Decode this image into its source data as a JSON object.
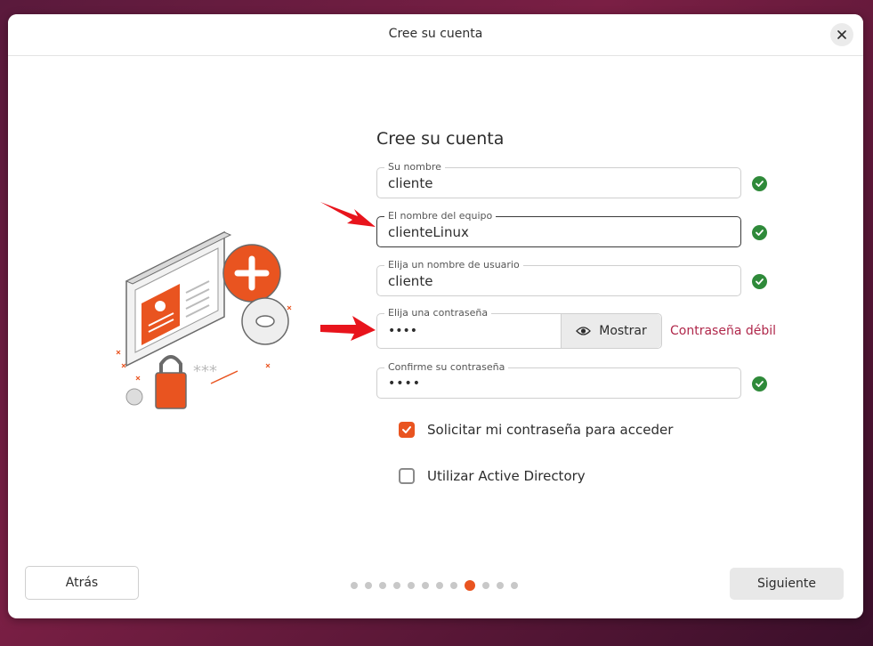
{
  "window": {
    "title": "Cree su cuenta"
  },
  "heading": "Cree su cuenta",
  "fields": {
    "name": {
      "label": "Su nombre",
      "value": "cliente",
      "valid": true
    },
    "computer": {
      "label": "El nombre del equipo",
      "value": "clienteLinux",
      "valid": true
    },
    "username": {
      "label": "Elija un nombre de usuario",
      "value": "cliente",
      "valid": true
    },
    "password": {
      "label": "Elija una contraseña",
      "value": "••••",
      "show_label": "Mostrar",
      "strength": "Contraseña débil"
    },
    "confirm": {
      "label": "Confirme su contraseña",
      "value": "••••",
      "valid": true
    }
  },
  "options": {
    "require_password": {
      "label": "Solicitar mi contraseña para acceder",
      "checked": true
    },
    "active_directory": {
      "label": "Utilizar Active Directory",
      "checked": false
    }
  },
  "buttons": {
    "back": "Atrás",
    "next": "Siguiente"
  },
  "pagination": {
    "total": 12,
    "current": 9
  },
  "colors": {
    "accent": "#e95420",
    "valid": "#2f8a3a",
    "weak": "#b0284b",
    "arrow": "#e8141c"
  },
  "icons": [
    "close-icon",
    "check-icon",
    "eye-icon",
    "arrow-icon",
    "checkbox-checked-icon"
  ]
}
